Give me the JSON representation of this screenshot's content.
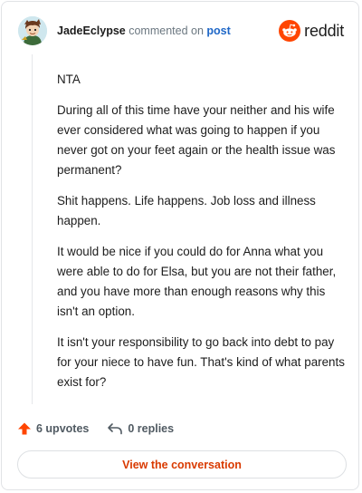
{
  "comment": {
    "username": "JadeEclypse",
    "action_text": "commented on",
    "post_link": "post",
    "paragraphs": [
      "NTA",
      "During all of this time have your neither and his wife ever considered what was going to happen if you never got on your feet again or the health issue was permanent?",
      "Shit happens. Life happens. Job loss and illness happen.",
      "It would be nice if you could do for Anna what you were able to do for Elsa, but you are not their father, and you have more than enough reasons why this isn't an option.",
      "It isn't your responsibility to go back into debt to pay for your niece to have fun. That's kind of what parents exist for?"
    ]
  },
  "brand": {
    "wordmark": "reddit",
    "icon": "reddit-snoo-icon",
    "color": "#ff4500"
  },
  "footer": {
    "upvotes_label": "6 upvotes",
    "replies_label": "0 replies",
    "upvote_icon": "upvote-arrow-icon",
    "reply_icon": "reply-arrow-icon",
    "accent": "#ff4500"
  },
  "cta": {
    "label": "View the conversation",
    "color": "#d93a00"
  }
}
